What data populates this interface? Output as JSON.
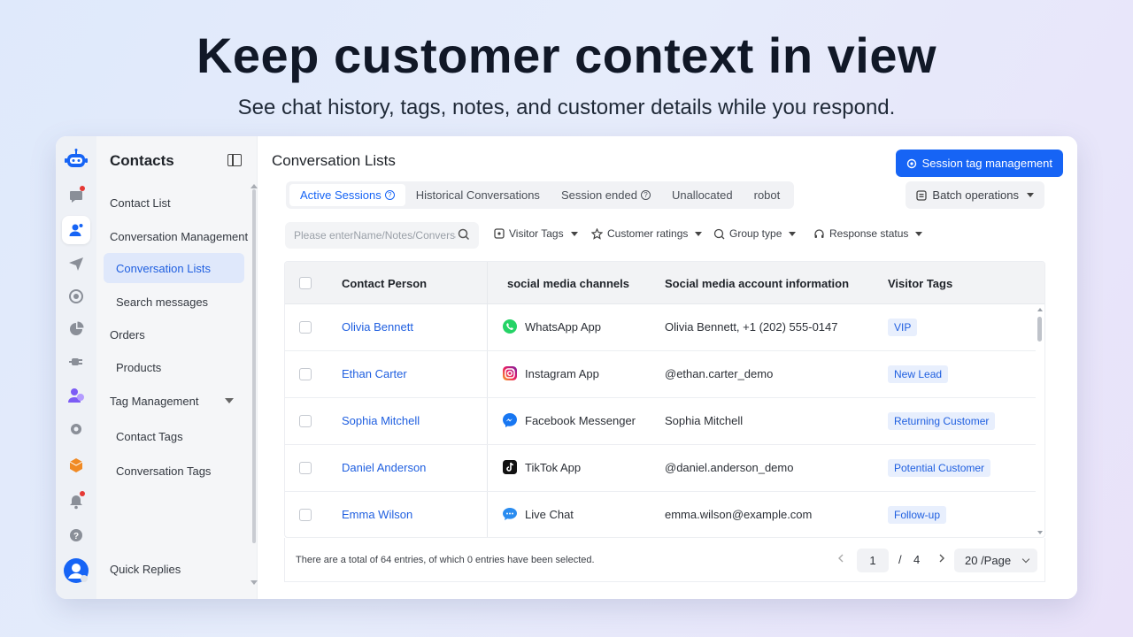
{
  "hero": {
    "title": "Keep customer context in view",
    "subtitle": "See chat history, tags, notes, and customer details while you respond."
  },
  "rail": {
    "icons": [
      "bot-logo-icon",
      "chat-icon",
      "contacts-icon",
      "send-icon",
      "target-icon",
      "pie-chart-icon",
      "plug-icon",
      "team-icon",
      "settings-icon",
      "box-icon",
      "bell-icon",
      "help-icon",
      "user-avatar"
    ]
  },
  "nav": {
    "header": "Contacts",
    "items": {
      "contact_list": "Contact List",
      "conversation_management": "Conversation Management",
      "conversation_lists": "Conversation Lists",
      "search_messages": "Search messages",
      "orders": "Orders",
      "products": "Products",
      "tag_management": "Tag Management",
      "contact_tags": "Contact Tags",
      "conversation_tags": "Conversation Tags",
      "quick_replies": "Quick Replies"
    }
  },
  "main": {
    "title": "Conversation Lists",
    "primary_button": "Session tag management",
    "batch_button": "Batch operations",
    "tabs": {
      "active_sessions": "Active Sessions",
      "historical": "Historical Conversations",
      "ended": "Session ended",
      "unallocated": "Unallocated",
      "robot": "robot"
    },
    "search_placeholder": "Please enterName/Notes/Conversati",
    "filters": {
      "visitor_tags": "Visitor Tags",
      "customer_ratings": "Customer ratings",
      "group_type": "Group type",
      "response_status": "Response status"
    }
  },
  "table": {
    "headers": {
      "contact": "Contact Person",
      "channel": "social media channels",
      "account": "Social media account information",
      "tags": "Visitor Tags"
    },
    "rows": [
      {
        "name": "Olivia Bennett",
        "channel": "WhatsApp App",
        "account": "Olivia Bennett, +1 (202) 555-0147",
        "tag": "VIP"
      },
      {
        "name": "Ethan Carter",
        "channel": "Instagram App",
        "account": "@ethan.carter_demo",
        "tag": "New Lead"
      },
      {
        "name": "Sophia Mitchell",
        "channel": "Facebook Messenger",
        "account": "Sophia Mitchell",
        "tag": "Returning Customer"
      },
      {
        "name": "Daniel Anderson",
        "channel": "TikTok App",
        "account": "@daniel.anderson_demo",
        "tag": "Potential Customer"
      },
      {
        "name": "Emma Wilson",
        "channel": "Live Chat",
        "account": "emma.wilson@example.com",
        "tag": "Follow-up"
      }
    ]
  },
  "footer": {
    "total_text": "There are a total of 64 entries, of which 0 entries have been selected.",
    "current_page": "1",
    "separator": "/",
    "total_pages": "4",
    "per_page": "20 /Page"
  },
  "colors": {
    "accent": "#1664f5",
    "link": "#1f5fe0",
    "tag_bg": "#e8effd"
  }
}
